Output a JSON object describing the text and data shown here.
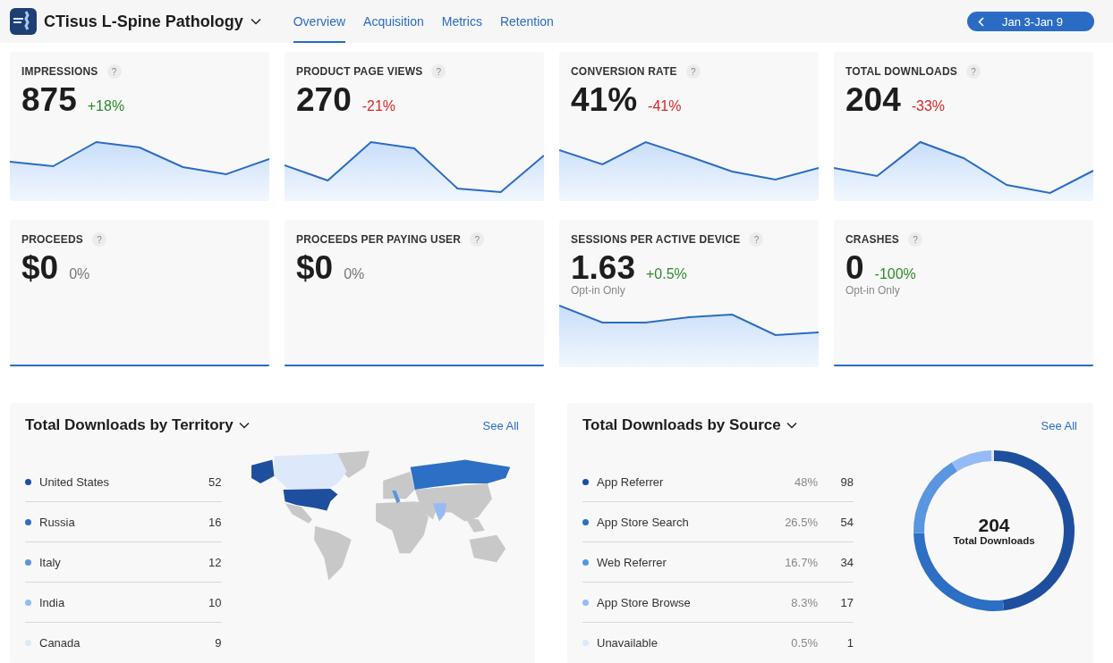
{
  "header": {
    "app_title": "CTisus L-Spine Pathology",
    "tabs": [
      {
        "label": "Overview",
        "selected": true
      },
      {
        "label": "Acquisition",
        "selected": false
      },
      {
        "label": "Metrics",
        "selected": false
      },
      {
        "label": "Retention",
        "selected": false
      }
    ],
    "date_range": "Jan 3-Jan 9"
  },
  "metrics": [
    {
      "title": "IMPRESSIONS",
      "help": "?",
      "value": "875",
      "change": "+18%",
      "color": "#2f8a2a",
      "kind": "trend"
    },
    {
      "title": "PRODUCT PAGE VIEWS",
      "help": "?",
      "value": "270",
      "change": "-21%",
      "color": "#d8262b",
      "kind": "trend"
    },
    {
      "title": "CONVERSION RATE",
      "help": "?",
      "value": "41%",
      "change": "-41%",
      "color": "#d8262b",
      "kind": "trend"
    },
    {
      "title": "TOTAL DOWNLOADS",
      "help": "?",
      "value": "204",
      "change": "-33%",
      "color": "#d8262b",
      "kind": "trend"
    },
    {
      "title": "PROCEEDS",
      "help": "?",
      "value": "$0",
      "change": "0%",
      "color": "#777777",
      "kind": "flat"
    },
    {
      "title": "PROCEEDS PER PAYING USER",
      "help": "?",
      "value": "$0",
      "change": "0%",
      "color": "#777777",
      "kind": "flat"
    },
    {
      "title": "SESSIONS PER ACTIVE DEVICE",
      "help": "?",
      "value": "1.63",
      "change": "+0.5%",
      "color": "#2f8a2a",
      "note": "Opt-in Only",
      "kind": "trend"
    },
    {
      "title": "CRASHES",
      "help": "?",
      "value": "0",
      "change": "-100%",
      "color": "#2f8a2a",
      "note": "Opt-in Only",
      "kind": "flat"
    }
  ],
  "territory_panel": {
    "title": "Total Downloads by Territory",
    "see_all": "See All",
    "items": [
      {
        "name": "United States",
        "count": "52",
        "color": "#1e4e9e"
      },
      {
        "name": "Russia",
        "count": "16",
        "color": "#2c6fc4"
      },
      {
        "name": "Italy",
        "count": "12",
        "color": "#5a95e0"
      },
      {
        "name": "India",
        "count": "10",
        "color": "#94bbf3"
      },
      {
        "name": "Canada",
        "count": "9",
        "color": "#dde8fb"
      }
    ]
  },
  "source_panel": {
    "title": "Total Downloads by Source",
    "see_all": "See All",
    "items": [
      {
        "name": "App Referrer",
        "percent": "48%",
        "count": "98",
        "color": "#1e4e9e"
      },
      {
        "name": "App Store Search",
        "percent": "26.5%",
        "count": "54",
        "color": "#2c6fc4"
      },
      {
        "name": "Web Referrer",
        "percent": "16.7%",
        "count": "34",
        "color": "#5a95e0"
      },
      {
        "name": "App Store Browse",
        "percent": "8.3%",
        "count": "17",
        "color": "#94bbf3"
      },
      {
        "name": "Unavailable",
        "percent": "0.5%",
        "count": "1",
        "color": "#dde8fb"
      }
    ],
    "center_value": "204",
    "chart_data": {
      "type": "donut",
      "series": [
        {
          "name": "Total Downloads",
          "values": [
            48,
            26.5,
            16.7,
            8.3,
            0.5
          ]
        }
      ]
    }
  }
}
